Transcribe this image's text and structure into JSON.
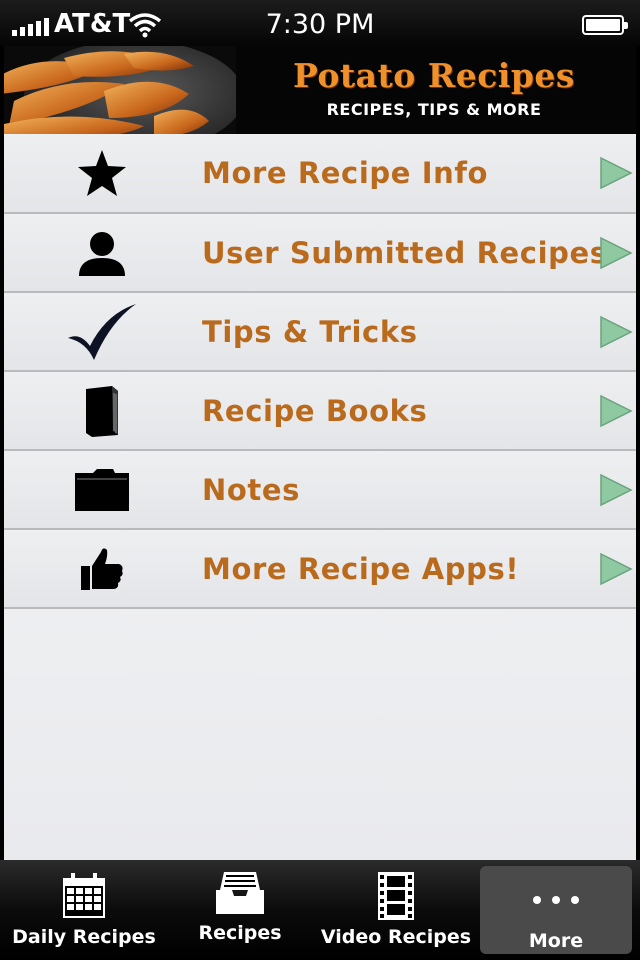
{
  "status_bar": {
    "carrier": "AT&T",
    "time": "7:30 PM"
  },
  "header": {
    "title": "Potato Recipes",
    "subtitle": "RECIPES, TIPS & MORE"
  },
  "menu": {
    "items": [
      {
        "label": "More Recipe Info",
        "icon": "star-icon"
      },
      {
        "label": "User Submitted Recipes",
        "icon": "user-icon"
      },
      {
        "label": "Tips & Tricks",
        "icon": "checkmark-icon"
      },
      {
        "label": "Recipe Books",
        "icon": "book-icon"
      },
      {
        "label": "Notes",
        "icon": "folder-icon"
      },
      {
        "label": "More Recipe Apps!",
        "icon": "thumbs-up-icon"
      }
    ]
  },
  "tabs": [
    {
      "label": "Daily Recipes",
      "icon": "calendar-icon"
    },
    {
      "label": "Recipes",
      "icon": "inbox-tray-icon"
    },
    {
      "label": "Video Recipes",
      "icon": "film-strip-icon"
    },
    {
      "label": "More",
      "icon": "more-dots-icon",
      "active": true
    }
  ],
  "colors": {
    "accent": "#b96a1c",
    "title": "#f0902a",
    "arrow": "#8fc9a2"
  }
}
